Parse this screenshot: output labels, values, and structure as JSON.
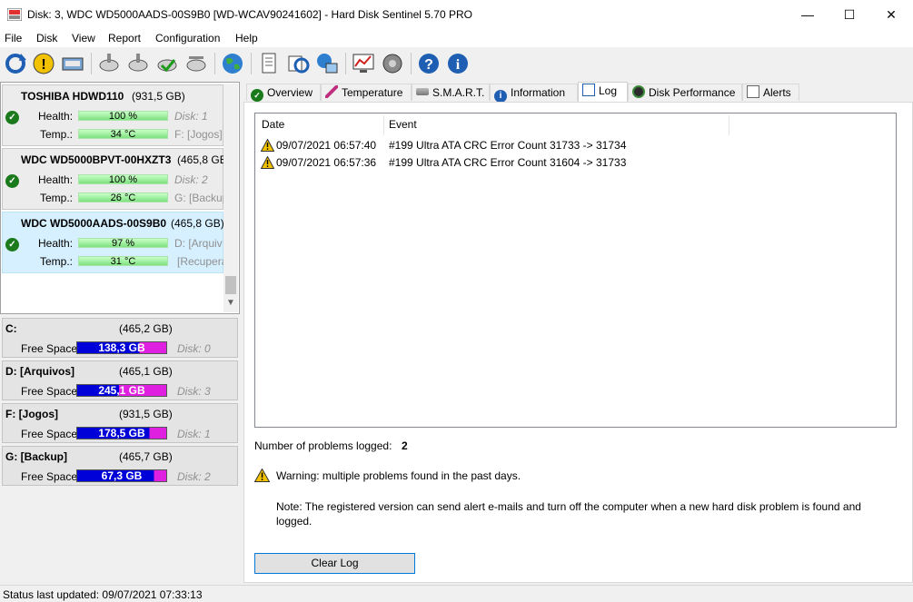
{
  "window": {
    "title": "Disk: 3, WDC WD5000AADS-00S9B0 [WD-WCAV90241602]  -  Hard Disk Sentinel 5.70 PRO",
    "minimize": "—",
    "maximize": "☐",
    "close": "✕"
  },
  "menu": [
    "File",
    "Disk",
    "View",
    "Report",
    "Configuration",
    "Help"
  ],
  "disks": [
    {
      "name": "TOSHIBA HDWD110",
      "size": "(931,5 GB)",
      "health_label": "Health:",
      "health": "100 %",
      "health_value": 100,
      "temp_label": "Temp.:",
      "temp": "34 °C",
      "disk": "Disk: 1",
      "drive": "F: [Jogos]"
    },
    {
      "name": "WDC WD5000BPVT-00HXZT3",
      "size": "(465,8 GB)",
      "health_label": "Health:",
      "health": "100 %",
      "health_value": 100,
      "temp_label": "Temp.:",
      "temp": "26 °C",
      "disk": "Disk: 2",
      "drive": "G: [Backup"
    },
    {
      "name": "WDC WD5000AADS-00S9B0",
      "size": "(465,8 GB)",
      "health_label": "Health:",
      "health": "97 %",
      "health_value": 97,
      "temp_label": "Temp.:",
      "temp": "31 °C",
      "disk": "D: [Arquiv",
      "drive": "[Recupera"
    }
  ],
  "volumes": [
    {
      "name": "C:",
      "size": "(465,2 GB)",
      "free_label": "Free Space",
      "free": "138,3 GB",
      "disk": "Disk: 0",
      "used_pct": 70
    },
    {
      "name": "D: [Arquivos]",
      "size": "(465,1 GB)",
      "free_label": "Free Space",
      "free": "245,1 GB",
      "disk": "Disk: 3",
      "used_pct": 47
    },
    {
      "name": "F: [Jogos]",
      "size": "(931,5 GB)",
      "free_label": "Free Space",
      "free": "178,5 GB",
      "disk": "Disk: 1",
      "used_pct": 81
    },
    {
      "name": "G: [Backup]",
      "size": "(465,7 GB)",
      "free_label": "Free Space",
      "free": "67,3 GB",
      "disk": "Disk: 2",
      "used_pct": 86
    }
  ],
  "tabs": [
    "Overview",
    "Temperature",
    "S.M.A.R.T.",
    "Information",
    "Log",
    "Disk Performance",
    "Alerts"
  ],
  "log": {
    "col_date": "Date",
    "col_event": "Event",
    "rows": [
      {
        "date": "09/07/2021 06:57:40",
        "event": "#199  Ultra ATA CRC Error Count  31733 -> 31734"
      },
      {
        "date": "09/07/2021 06:57:36",
        "event": "#199  Ultra ATA CRC Error Count  31604 -> 31733"
      }
    ],
    "problems_label": "Number of problems logged:",
    "problems_count": "2",
    "warning": "Warning: multiple problems found in the past days.",
    "note_line1": "Note: The registered version can send alert e-mails and turn off the computer when a new hard disk problem is found and",
    "note_line2": "logged.",
    "clear_button": "Clear Log"
  },
  "status": "Status last updated: 09/07/2021 07:33:13"
}
